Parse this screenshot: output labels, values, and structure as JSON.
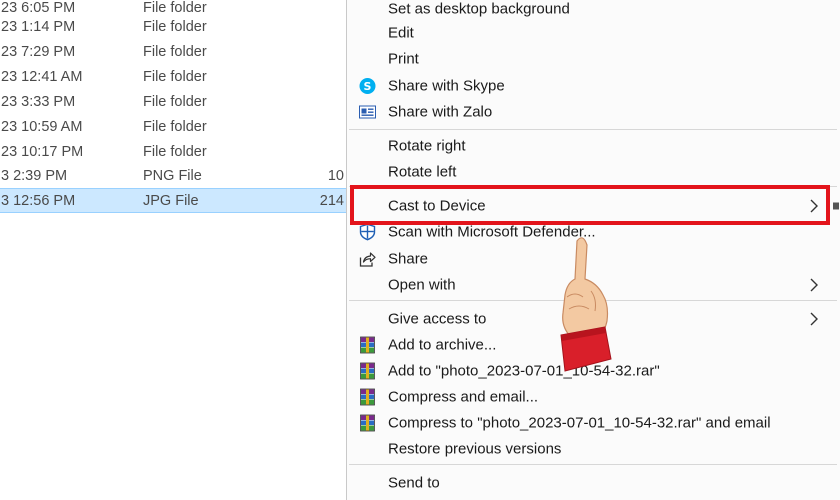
{
  "file_list": {
    "rows": [
      {
        "date": "23 6:05 PM",
        "type": "File folder",
        "size": ""
      },
      {
        "date": "23 1:14 PM",
        "type": "File folder",
        "size": ""
      },
      {
        "date": "23 7:29 PM",
        "type": "File folder",
        "size": ""
      },
      {
        "date": "23 12:41 AM",
        "type": "File folder",
        "size": ""
      },
      {
        "date": "23 3:33 PM",
        "type": "File folder",
        "size": ""
      },
      {
        "date": "23 10:59 AM",
        "type": "File folder",
        "size": ""
      },
      {
        "date": "23 10:17 PM",
        "type": "File folder",
        "size": ""
      },
      {
        "date": "3 2:39 PM",
        "type": "PNG File",
        "size": "10"
      },
      {
        "date": "3 12:56 PM",
        "type": "JPG File",
        "size": "214",
        "selected": true
      }
    ]
  },
  "context_menu": {
    "items": [
      {
        "label": "Set as desktop background",
        "icon": null
      },
      {
        "label": "Edit",
        "icon": null
      },
      {
        "label": "Print",
        "icon": null
      },
      {
        "label": "Share with Skype",
        "icon": "skype-icon"
      },
      {
        "label": "Share with Zalo",
        "icon": "zalo-icon"
      },
      {
        "label": "Rotate right",
        "icon": null
      },
      {
        "label": "Rotate left",
        "icon": null
      },
      {
        "label": "Cast to Device",
        "icon": null,
        "submenu": true,
        "highlighted": true
      },
      {
        "label": "Scan with Microsoft Defender...",
        "icon": "defender-shield-icon"
      },
      {
        "label": "Share",
        "icon": "share-icon"
      },
      {
        "label": "Open with",
        "icon": null,
        "submenu": true
      },
      {
        "label": "Give access to",
        "icon": null,
        "submenu": true
      },
      {
        "label": "Add to archive...",
        "icon": "winrar-icon"
      },
      {
        "label": "Add to \"photo_2023-07-01_10-54-32.rar\"",
        "icon": "winrar-icon"
      },
      {
        "label": "Compress and email...",
        "icon": "winrar-icon"
      },
      {
        "label": "Compress to \"photo_2023-07-01_10-54-32.rar\" and email",
        "icon": "winrar-icon"
      },
      {
        "label": "Restore previous versions",
        "icon": null
      },
      {
        "label": "Send to",
        "icon": null,
        "submenu": true
      }
    ]
  },
  "colors": {
    "highlight_border": "#e3141b",
    "selection": "#cce8ff",
    "skype": "#00aff0",
    "defender": "#1f5fb4"
  }
}
